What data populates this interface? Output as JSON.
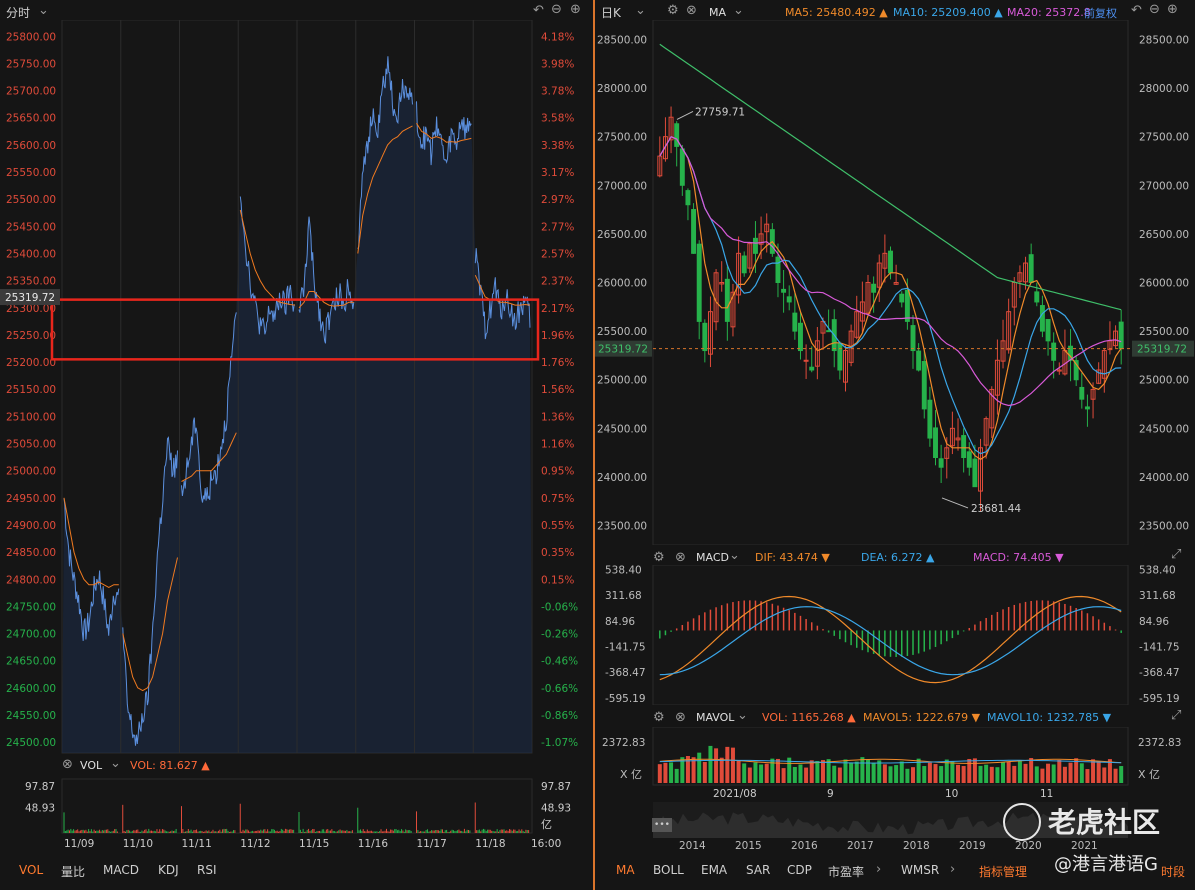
{
  "left_panel": {
    "header_label": "分时",
    "vol_label": "VOL",
    "vol_value": "VOL: 81.627 ▲",
    "vol_unit": "亿",
    "vol_ticks": [
      "97.87",
      "48.93"
    ],
    "price_tag": "25319.72",
    "tabs": [
      "VOL",
      "量比",
      "MACD",
      "KDJ",
      "RSI"
    ]
  },
  "right_panel": {
    "header_label": "日K",
    "ma_label": "MA",
    "ma5": "MA5: 25480.492 ▲",
    "ma10": "MA10: 25209.400 ▲",
    "ma20": "MA20: 25372.8",
    "fq_label": "前复权",
    "price_tag": "25319.72",
    "annot_high": "27759.71",
    "annot_low": "23681.44",
    "macd_label": "MACD",
    "dif": "DIF: 43.474 ▼",
    "dea": "DEA: 6.272 ▲",
    "macd": "MACD: 74.405 ▼",
    "mavol_label": "MAVOL",
    "vol": "VOL: 1165.268 ▲",
    "mavol5": "MAVOL5: 1222.679 ▼",
    "mavol10": "MAVOL10: 1232.785 ▼",
    "vol_unit_left": "X 亿",
    "vol_unit_right": "X 亿",
    "vol_tick": "2372.83",
    "months": [
      "2021/08",
      "9",
      "10",
      "11"
    ],
    "years": [
      "2014",
      "2015",
      "2016",
      "2017",
      "2018",
      "2019",
      "2020",
      "2021"
    ],
    "tabs": [
      "MA",
      "BOLL",
      "EMA",
      "SAR",
      "CDP",
      "市盈率",
      "WMSR",
      "指标管理",
      "时段"
    ],
    "watermark_brand": "老虎社区",
    "watermark_user": "@港言港语G"
  },
  "colors": {
    "up": "#e04b3a",
    "down": "#26b24b",
    "price_line": "#5b8fdd",
    "avg_line": "#f07a20",
    "highlight_box": "#e8261c",
    "accent": "#ff7a2f"
  },
  "chart_data": [
    {
      "type": "line",
      "title": "分时",
      "x_tick_labels": [
        "11/09",
        "11/10",
        "11/11",
        "11/12",
        "11/15",
        "11/16",
        "11/17",
        "11/18",
        "16:00"
      ],
      "y_left_ticks": [
        25800,
        25750,
        25700,
        25650,
        25600,
        25550,
        25500,
        25450,
        25400,
        25350,
        25300,
        25250,
        25200,
        25150,
        25100,
        25050,
        25000,
        24950,
        24900,
        24850,
        24800,
        24750,
        24700,
        24650,
        24600,
        24550,
        24500
      ],
      "y_right_ticks": [
        "4.18%",
        "3.98%",
        "3.78%",
        "3.58%",
        "3.38%",
        "3.17%",
        "2.97%",
        "2.77%",
        "2.57%",
        "2.37%",
        "2.17%",
        "1.96%",
        "1.76%",
        "1.56%",
        "1.36%",
        "1.16%",
        "0.95%",
        "0.75%",
        "0.55%",
        "0.35%",
        "0.15%",
        "-0.06%",
        "-0.26%",
        "-0.46%",
        "-0.66%",
        "-0.86%",
        "-1.07%"
      ],
      "ylim": [
        24480,
        25830
      ],
      "highlight_range": [
        25205,
        25315
      ],
      "sessions": [
        {
          "label": "11/09",
          "price": [
            24950,
            24850,
            24800,
            24760,
            24700,
            24720,
            24780,
            24810,
            24760,
            24700,
            24780,
            24760
          ],
          "avg": [
            24950,
            24900,
            24850,
            24820,
            24800,
            24790,
            24790,
            24795,
            24790,
            24785,
            24790,
            24790
          ]
        },
        {
          "label": "11/10",
          "price": [
            24700,
            24560,
            24520,
            24500,
            24550,
            24580,
            24700,
            24850,
            24950,
            25050,
            25000,
            25020
          ],
          "avg": [
            24700,
            24660,
            24620,
            24600,
            24595,
            24600,
            24620,
            24660,
            24700,
            24760,
            24800,
            24840
          ]
        },
        {
          "label": "11/11",
          "price": [
            24950,
            25000,
            25050,
            25100,
            24950,
            24950,
            24980,
            25000,
            25050,
            25100,
            25200,
            25280
          ],
          "avg": [
            24980,
            24985,
            24990,
            25000,
            25000,
            25000,
            25000,
            25010,
            25020,
            25030,
            25050,
            25070
          ]
        },
        {
          "label": "11/12",
          "price": [
            25520,
            25420,
            25350,
            25300,
            25270,
            25250,
            25300,
            25280,
            25320,
            25300,
            25330,
            25300
          ],
          "avg": [
            25480,
            25440,
            25400,
            25370,
            25350,
            25335,
            25325,
            25315,
            25310,
            25308,
            25306,
            25305
          ]
        },
        {
          "label": "11/15",
          "price": [
            25300,
            25330,
            25460,
            25350,
            25300,
            25250,
            25280,
            25300,
            25330,
            25300,
            25350,
            25310
          ],
          "avg": [
            25300,
            25310,
            25330,
            25330,
            25320,
            25310,
            25305,
            25303,
            25304,
            25305,
            25310,
            25310
          ]
        },
        {
          "label": "11/16",
          "price": [
            25400,
            25570,
            25600,
            25650,
            25620,
            25700,
            25750,
            25680,
            25650,
            25700,
            25710,
            25680
          ],
          "avg": [
            25400,
            25470,
            25510,
            25540,
            25560,
            25580,
            25600,
            25610,
            25615,
            25625,
            25630,
            25635
          ]
        },
        {
          "label": "11/17",
          "price": [
            25660,
            25600,
            25620,
            25580,
            25650,
            25600,
            25560,
            25620,
            25600,
            25650,
            25620,
            25650
          ],
          "avg": [
            25640,
            25625,
            25620,
            25612,
            25615,
            25612,
            25605,
            25606,
            25605,
            25608,
            25610,
            25612
          ]
        },
        {
          "label": "11/18",
          "price": [
            25400,
            25330,
            25260,
            25300,
            25340,
            25290,
            25320,
            25300,
            25270,
            25300,
            25310,
            25280
          ],
          "avg": [
            25360,
            25340,
            25320,
            25315,
            25315,
            25310,
            25310,
            25308,
            25305,
            25305,
            25306,
            25305
          ]
        }
      ],
      "volume": {
        "ylim": [
          0,
          100
        ],
        "ticks": [
          97.87,
          48.93
        ]
      }
    },
    {
      "type": "line",
      "title": "日K",
      "series": [
        {
          "name": "MA5",
          "values": [
            25480.492
          ]
        },
        {
          "name": "MA10",
          "values": [
            25209.4
          ]
        },
        {
          "name": "MA20",
          "values": [
            25372.8
          ]
        }
      ],
      "y_ticks": [
        28500,
        28000,
        27500,
        27000,
        26500,
        26000,
        25500,
        25000,
        24500,
        24000,
        23500
      ],
      "ylim": [
        23300,
        28700
      ],
      "x_tick_labels": [
        "2021/08",
        "9",
        "10",
        "11"
      ],
      "annotations": [
        {
          "text": "27759.71",
          "value": 27759.71
        },
        {
          "text": "23681.44",
          "value": 23681.44
        }
      ],
      "current_price": 25319.72,
      "candles_close": [
        27300,
        27500,
        27700,
        27400,
        27000,
        26800,
        26300,
        25600,
        25300,
        25700,
        26100,
        26000,
        25600,
        25900,
        26300,
        26100,
        26400,
        26300,
        26500,
        26600,
        26300,
        26000,
        25900,
        25800,
        25500,
        25300,
        25200,
        25100,
        25400,
        25600,
        25500,
        25300,
        25100,
        25300,
        25500,
        25700,
        25800,
        26000,
        25900,
        26200,
        26300,
        26100,
        26000,
        25800,
        25600,
        25300,
        25100,
        24700,
        24400,
        24200,
        24100,
        24300,
        24500,
        24400,
        24200,
        24100,
        23900,
        24300,
        24600,
        24900,
        25200,
        25400,
        25700,
        26000,
        26100,
        26200,
        26000,
        25800,
        25500,
        25400,
        25200,
        25100,
        25300,
        25200,
        25000,
        24800,
        24700,
        24900,
        25100,
        25300,
        25400,
        25500,
        25320
      ],
      "macd": {
        "ticks": [
          538.4,
          311.68,
          84.96,
          -141.75,
          -368.47,
          -595.19
        ],
        "DIF": 43.474,
        "DEA": 6.272,
        "MACD": 74.405
      },
      "mavol": {
        "ticks": [
          2372.83
        ],
        "VOL": 1165.268,
        "MAVOL5": 1222.679,
        "MAVOL10": 1232.785
      }
    }
  ]
}
